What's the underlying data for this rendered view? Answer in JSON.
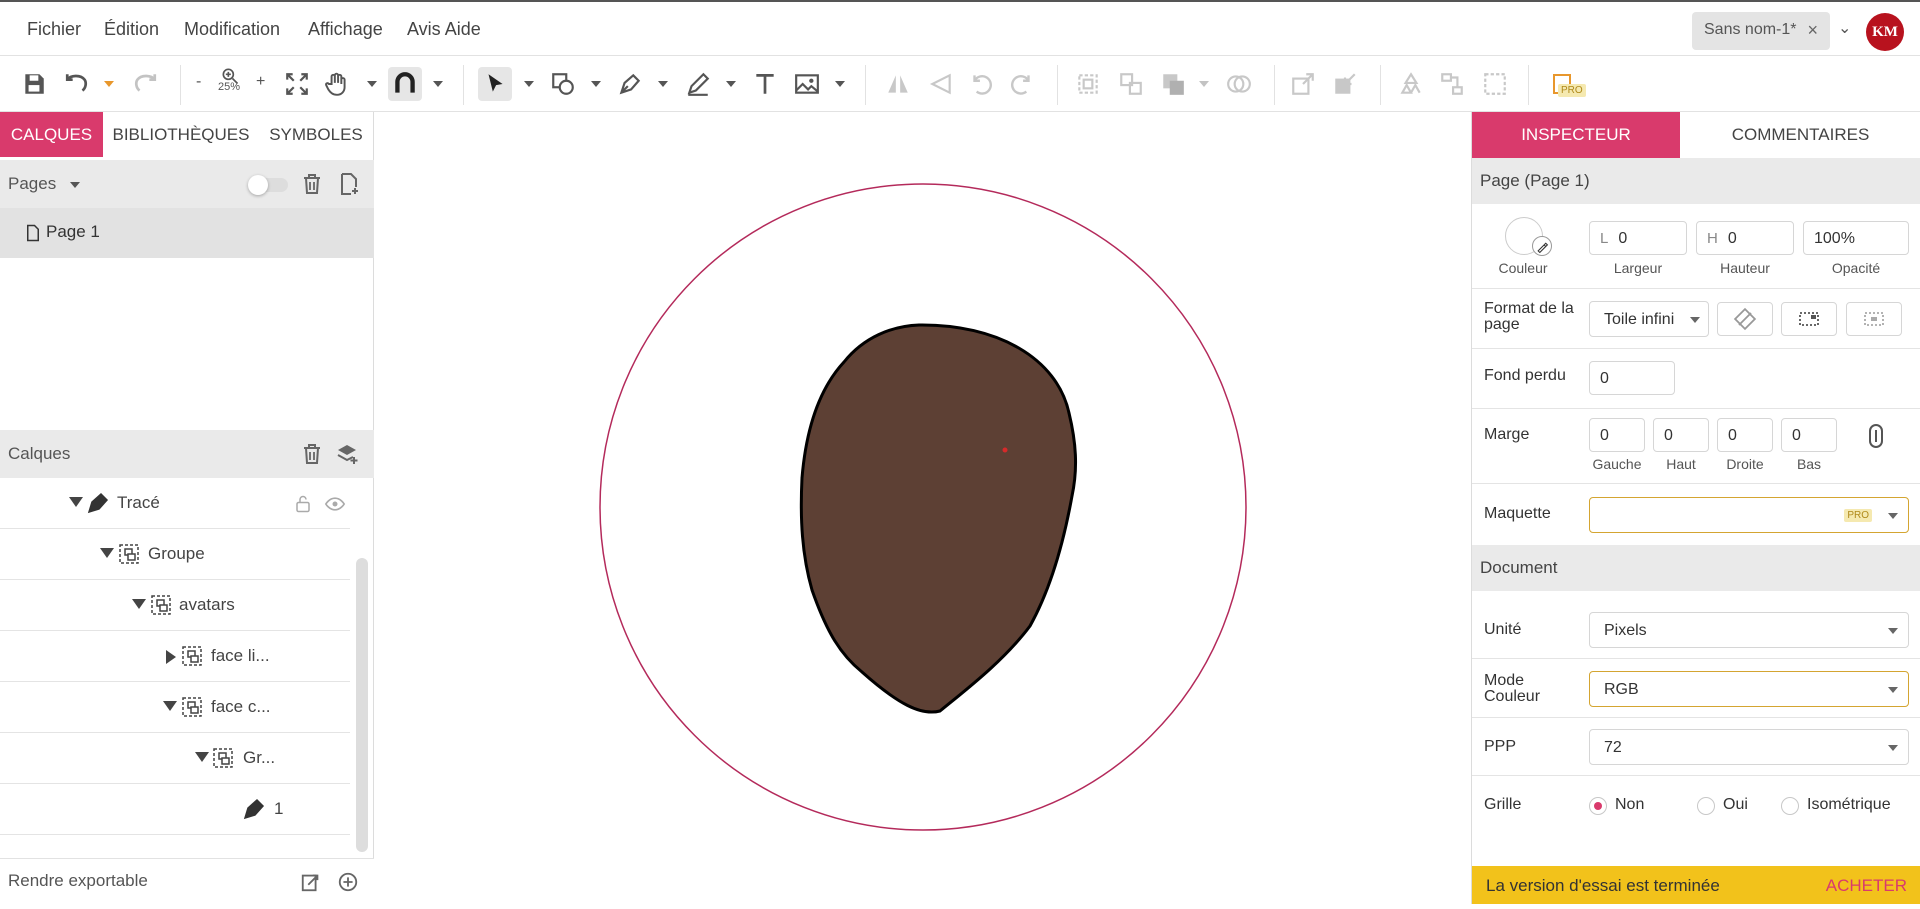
{
  "menubar": {
    "items": [
      "Fichier",
      "Édition",
      "Modification",
      "Affichage",
      "Avis Aide"
    ],
    "doc_tab": "Sans nom-1*",
    "avatar_initials": "KM"
  },
  "toolbar": {
    "zoom_minus": "-",
    "zoom_plus": "+",
    "zoom_level": "25%",
    "pro_badge": "PRO"
  },
  "left_panel": {
    "tabs": [
      "CALQUES",
      "BIBLIOTHÈQUES",
      "SYMBOLES"
    ],
    "active_tab": "CALQUES",
    "pages_label": "Pages",
    "pages": [
      "Page 1"
    ],
    "layers_label": "Calques",
    "layers": [
      {
        "label": "Tracé",
        "type": "path"
      },
      {
        "label": "Groupe",
        "type": "group"
      },
      {
        "label": "avatars",
        "type": "group"
      },
      {
        "label": "face li...",
        "type": "group"
      },
      {
        "label": "face c...",
        "type": "group"
      },
      {
        "label": "Gr...",
        "type": "group"
      },
      {
        "label": "1",
        "type": "path"
      }
    ],
    "footer": "Rendre exportable"
  },
  "canvas": {
    "circle_color": "#b42a5b",
    "face_color": "#5d4034"
  },
  "inspector": {
    "tabs": [
      "INSPECTEUR",
      "COMMENTAIRES"
    ],
    "active_tab": "INSPECTEUR",
    "page_title": "Page (Page 1)",
    "color_label": "Couleur",
    "width_prefix": "L",
    "width_value": "0",
    "width_label": "Largeur",
    "height_prefix": "H",
    "height_value": "0",
    "height_label": "Hauteur",
    "opacity_value": "100%",
    "opacity_label": "Opacité",
    "format_label": "Format de la page",
    "format_value": "Toile infini",
    "bleed_label": "Fond perdu",
    "bleed_value": "0",
    "margin_label": "Marge",
    "margins": [
      {
        "value": "0",
        "label": "Gauche"
      },
      {
        "value": "0",
        "label": "Haut"
      },
      {
        "value": "0",
        "label": "Droite"
      },
      {
        "value": "0",
        "label": "Bas"
      }
    ],
    "mockup_label": "Maquette",
    "mockup_pro": "PRO",
    "document_title": "Document",
    "unit_label": "Unité",
    "unit_value": "Pixels",
    "color_mode_label": "Mode Couleur",
    "color_mode_value": "RGB",
    "ppi_label": "PPP",
    "ppi_value": "72",
    "grid_label": "Grille",
    "grid_options": [
      "Non",
      "Oui",
      "Isométrique"
    ],
    "grid_selected": "Non",
    "trial_text": "La version d'essai est terminée",
    "buy_label": "ACHETER"
  },
  "colors": {
    "accent": "#d93a6c",
    "trial_bar": "#f2c21b",
    "avatar_bg": "#b8121e"
  }
}
